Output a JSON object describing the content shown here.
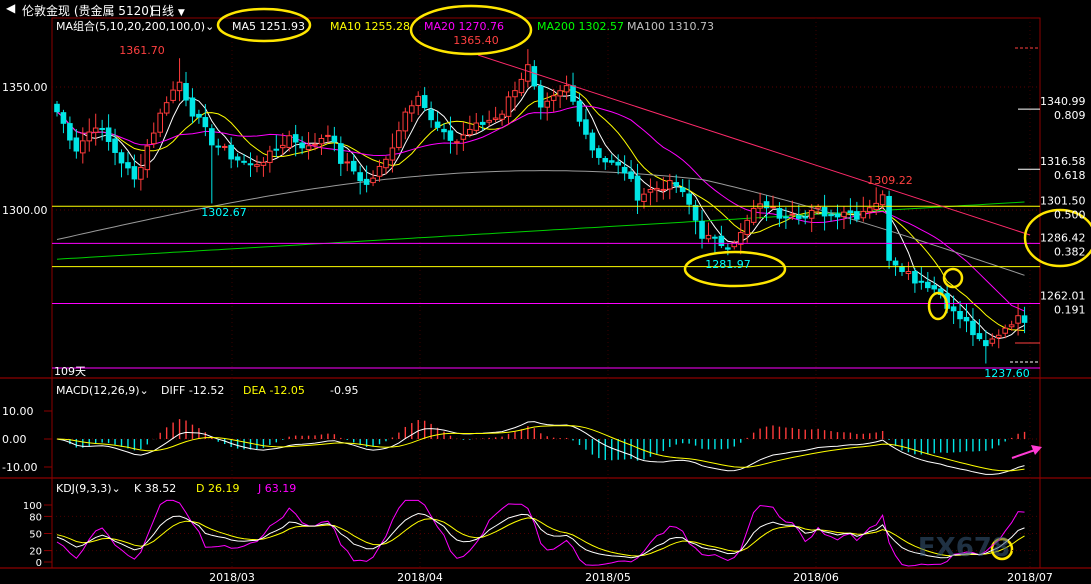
{
  "header": {
    "title": "伦敦金现 (贵金属 5120)",
    "period": "日线",
    "back_icon": "back-arrow-icon",
    "dropdown_icon": "chevron-down-icon"
  },
  "ma_legend": {
    "label": "MA组合(5,10,20,200,100,0)",
    "items": [
      {
        "text": "MA5 1251.93",
        "color": "#ffffff"
      },
      {
        "text": "MA10 1255.28",
        "color": "#ffff00"
      },
      {
        "text": "MA20 1270.76",
        "color": "#ff00ff"
      },
      {
        "text": "MA200 1302.57",
        "color": "#00ff00"
      },
      {
        "text": "MA100 1310.73",
        "color": "#c0c0c0"
      }
    ]
  },
  "macd_legend": {
    "label": "MACD(12,26,9)",
    "items": [
      {
        "text": "DIFF -12.52",
        "color": "#ffffff"
      },
      {
        "text": "DEA -12.05",
        "color": "#ffff00"
      },
      {
        "text": "-0.95",
        "color": "#ffffff"
      }
    ]
  },
  "kdj_legend": {
    "label": "KDJ(9,3,3)",
    "items": [
      {
        "text": "K 38.52",
        "color": "#ffffff"
      },
      {
        "text": "D 26.19",
        "color": "#ffff00"
      },
      {
        "text": "J 63.19",
        "color": "#ff00ff"
      }
    ]
  },
  "fib_levels": [
    {
      "price": "1340.99",
      "ratio": "0.809"
    },
    {
      "price": "1316.58",
      "ratio": "0.618"
    },
    {
      "price": "1301.50",
      "ratio": "0.500"
    },
    {
      "price": "1286.42",
      "ratio": "0.382"
    },
    {
      "price": "1262.01",
      "ratio": "0.191"
    }
  ],
  "extreme_labels": [
    {
      "text": "1361.70",
      "color": "#ff4040"
    },
    {
      "text": "1365.40",
      "color": "#ff4040"
    },
    {
      "text": "1302.67",
      "color": "#00ffff"
    },
    {
      "text": "1281.97",
      "color": "#00ffff"
    },
    {
      "text": "1309.22",
      "color": "#ff4040"
    },
    {
      "text": "1237.60",
      "color": "#00ffff"
    }
  ],
  "range_label": "109天",
  "watermark": "FX678",
  "chart_data": [
    {
      "type": "candlestick",
      "title": "",
      "price_axis_ticks": [
        "1350.00",
        "1300.00"
      ],
      "time_axis_ticks": [
        "2018/03",
        "2018/04",
        "2018/05",
        "2018/06",
        "2018/07"
      ],
      "close_points": [
        {
          "x": "2018/02 end",
          "y": 1320
        },
        {
          "x": "2018/03 early",
          "y": 1361.7
        },
        {
          "x": "2018/03 mid",
          "y": 1302.67
        },
        {
          "x": "2018/04 mid",
          "y": 1345
        },
        {
          "x": "2018/04 peak",
          "y": 1365.4
        },
        {
          "x": "2018/05 early",
          "y": 1305
        },
        {
          "x": "2018/05 low",
          "y": 1281.97
        },
        {
          "x": "2018/06 high",
          "y": 1309.22
        },
        {
          "x": "2018/06 end",
          "y": 1250
        },
        {
          "x": "2018/07 low",
          "y": 1237.6
        },
        {
          "x": "2018/07 last",
          "y": 1255
        }
      ],
      "moving_averages": [
        {
          "name": "MA5",
          "last": 1251.93,
          "color": "#ffffff"
        },
        {
          "name": "MA10",
          "last": 1255.28,
          "color": "#ffff00"
        },
        {
          "name": "MA20",
          "last": 1270.76,
          "color": "#ff00ff"
        },
        {
          "name": "MA200",
          "last": 1302.57,
          "color": "#00ff00"
        },
        {
          "name": "MA100",
          "last": 1310.73,
          "color": "#c0c0c0"
        }
      ],
      "ylim": [
        1230,
        1378
      ]
    },
    {
      "type": "bar",
      "title": "",
      "tick_labels": [
        "10.00",
        "0.00",
        "-10.00"
      ],
      "series": [
        {
          "name": "DIFF",
          "last": -12.52
        },
        {
          "name": "DEA",
          "last": -12.05
        },
        {
          "name": "MACD",
          "last": -0.95
        }
      ],
      "ylim": [
        -14,
        14
      ]
    },
    {
      "type": "line",
      "title": "",
      "tick_labels": [
        "100",
        "80",
        "50",
        "20",
        "0"
      ],
      "series": [
        {
          "name": "K",
          "last": 38.52
        },
        {
          "name": "D",
          "last": 26.19
        },
        {
          "name": "J",
          "last": 63.19
        }
      ],
      "ylim": [
        -10,
        110
      ]
    }
  ]
}
